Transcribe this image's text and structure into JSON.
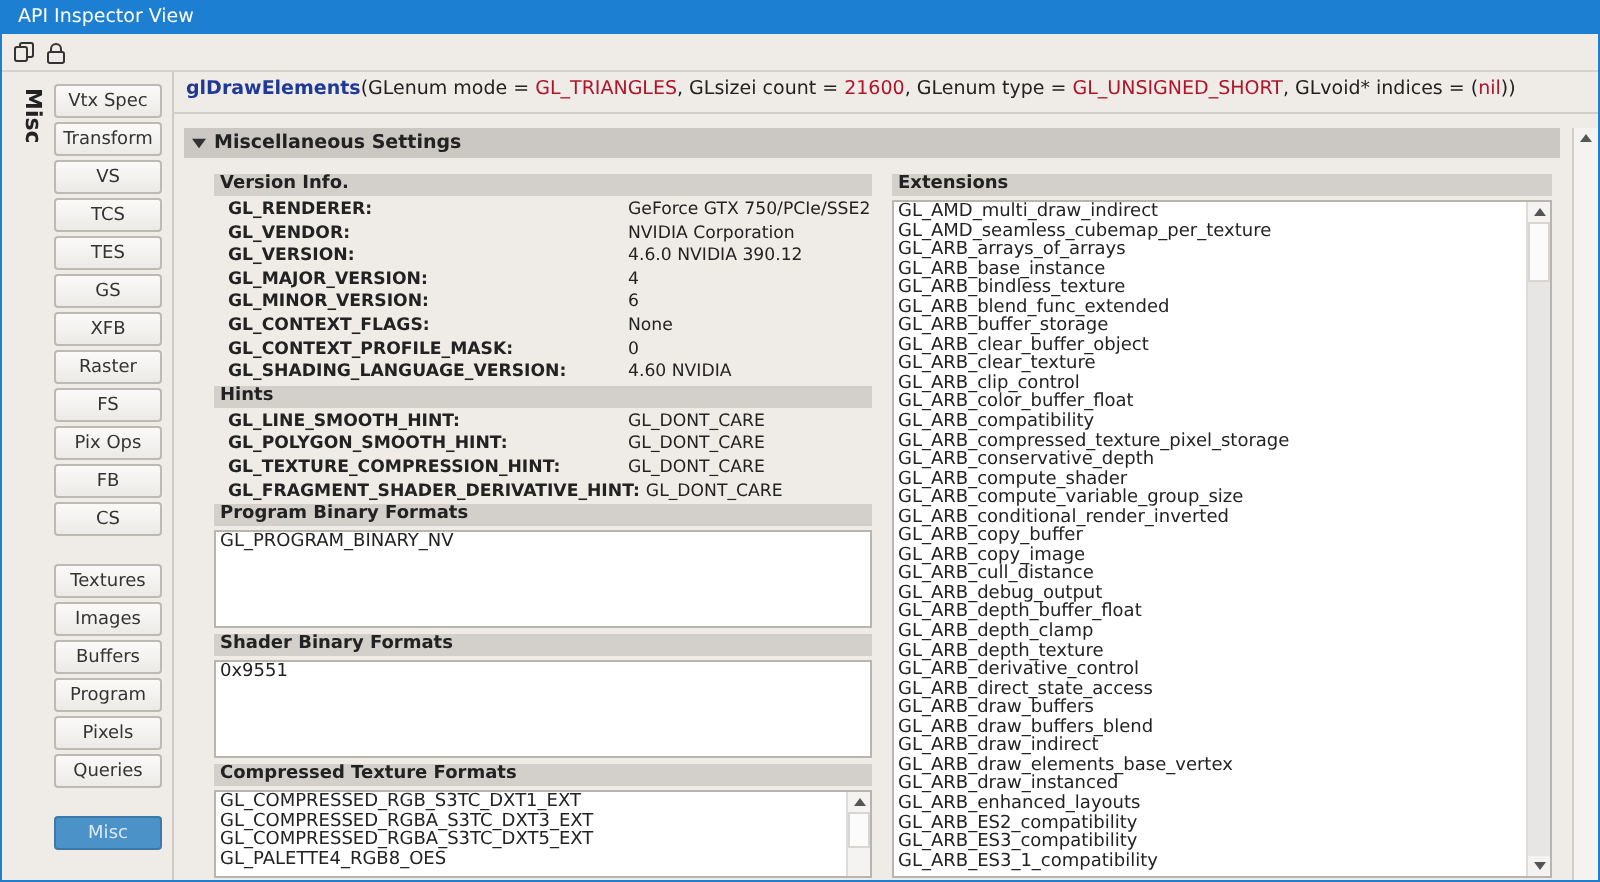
{
  "window": {
    "title": "API Inspector View"
  },
  "sidebar": {
    "label": "Misc",
    "groups": [
      [
        {
          "label": "Vtx Spec",
          "selected": false
        },
        {
          "label": "Transform",
          "selected": false
        },
        {
          "label": "VS",
          "selected": false
        },
        {
          "label": "TCS",
          "selected": false
        },
        {
          "label": "TES",
          "selected": false
        },
        {
          "label": "GS",
          "selected": false
        },
        {
          "label": "XFB",
          "selected": false
        },
        {
          "label": "Raster",
          "selected": false
        },
        {
          "label": "FS",
          "selected": false
        },
        {
          "label": "Pix Ops",
          "selected": false
        },
        {
          "label": "FB",
          "selected": false
        },
        {
          "label": "CS",
          "selected": false
        }
      ],
      [
        {
          "label": "Textures",
          "selected": false
        },
        {
          "label": "Images",
          "selected": false
        },
        {
          "label": "Buffers",
          "selected": false
        },
        {
          "label": "Program",
          "selected": false
        },
        {
          "label": "Pixels",
          "selected": false
        },
        {
          "label": "Queries",
          "selected": false
        }
      ],
      [
        {
          "label": "Misc",
          "selected": true
        }
      ]
    ]
  },
  "call": [
    {
      "kind": "name",
      "text": "glDrawElements"
    },
    {
      "kind": "plain",
      "text": "(GLenum mode = "
    },
    {
      "kind": "value",
      "text": "GL_TRIANGLES"
    },
    {
      "kind": "plain",
      "text": ", GLsizei count = "
    },
    {
      "kind": "value",
      "text": "21600"
    },
    {
      "kind": "plain",
      "text": ", GLenum type = "
    },
    {
      "kind": "value",
      "text": "GL_UNSIGNED_SHORT"
    },
    {
      "kind": "plain",
      "text": ", GLvoid* indices = ("
    },
    {
      "kind": "value",
      "text": "nil"
    },
    {
      "kind": "plain",
      "text": "))"
    }
  ],
  "section": {
    "title": "Miscellaneous Settings",
    "expanded": true
  },
  "version_info": {
    "title": "Version Info.",
    "rows": [
      {
        "name": "GL_RENDERER:",
        "value": "GeForce GTX 750/PCIe/SSE2"
      },
      {
        "name": "GL_VENDOR:",
        "value": "NVIDIA Corporation"
      },
      {
        "name": "GL_VERSION:",
        "value": "4.6.0 NVIDIA 390.12"
      },
      {
        "name": "GL_MAJOR_VERSION:",
        "value": "4"
      },
      {
        "name": "GL_MINOR_VERSION:",
        "value": "6"
      },
      {
        "name": "GL_CONTEXT_FLAGS:",
        "value": "None"
      },
      {
        "name": "GL_CONTEXT_PROFILE_MASK:",
        "value": "0"
      },
      {
        "name": "GL_SHADING_LANGUAGE_VERSION:",
        "value": "4.60 NVIDIA"
      }
    ]
  },
  "hints": {
    "title": "Hints",
    "rows": [
      {
        "name": "GL_LINE_SMOOTH_HINT:",
        "value": "GL_DONT_CARE"
      },
      {
        "name": "GL_POLYGON_SMOOTH_HINT:",
        "value": "GL_DONT_CARE"
      },
      {
        "name": "GL_TEXTURE_COMPRESSION_HINT:",
        "value": "GL_DONT_CARE"
      },
      {
        "name": "GL_FRAGMENT_SHADER_DERIVATIVE_HINT:",
        "value": "GL_DONT_CARE"
      }
    ]
  },
  "program_binary_formats": {
    "title": "Program Binary Formats",
    "items": [
      "GL_PROGRAM_BINARY_NV"
    ]
  },
  "shader_binary_formats": {
    "title": "Shader Binary Formats",
    "items": [
      "0x9551"
    ]
  },
  "compressed_texture_formats": {
    "title": "Compressed Texture Formats",
    "items": [
      "GL_COMPRESSED_RGB_S3TC_DXT1_EXT",
      "GL_COMPRESSED_RGBA_S3TC_DXT3_EXT",
      "GL_COMPRESSED_RGBA_S3TC_DXT5_EXT",
      "GL_PALETTE4_RGB8_OES"
    ]
  },
  "extensions": {
    "title": "Extensions",
    "items": [
      "GL_AMD_multi_draw_indirect",
      "GL_AMD_seamless_cubemap_per_texture",
      "GL_ARB_arrays_of_arrays",
      "GL_ARB_base_instance",
      "GL_ARB_bindless_texture",
      "GL_ARB_blend_func_extended",
      "GL_ARB_buffer_storage",
      "GL_ARB_clear_buffer_object",
      "GL_ARB_clear_texture",
      "GL_ARB_clip_control",
      "GL_ARB_color_buffer_float",
      "GL_ARB_compatibility",
      "GL_ARB_compressed_texture_pixel_storage",
      "GL_ARB_conservative_depth",
      "GL_ARB_compute_shader",
      "GL_ARB_compute_variable_group_size",
      "GL_ARB_conditional_render_inverted",
      "GL_ARB_copy_buffer",
      "GL_ARB_copy_image",
      "GL_ARB_cull_distance",
      "GL_ARB_debug_output",
      "GL_ARB_depth_buffer_float",
      "GL_ARB_depth_clamp",
      "GL_ARB_depth_texture",
      "GL_ARB_derivative_control",
      "GL_ARB_direct_state_access",
      "GL_ARB_draw_buffers",
      "GL_ARB_draw_buffers_blend",
      "GL_ARB_draw_indirect",
      "GL_ARB_draw_elements_base_vertex",
      "GL_ARB_draw_instanced",
      "GL_ARB_enhanced_layouts",
      "GL_ARB_ES2_compatibility",
      "GL_ARB_ES3_compatibility",
      "GL_ARB_ES3_1_compatibility"
    ]
  }
}
